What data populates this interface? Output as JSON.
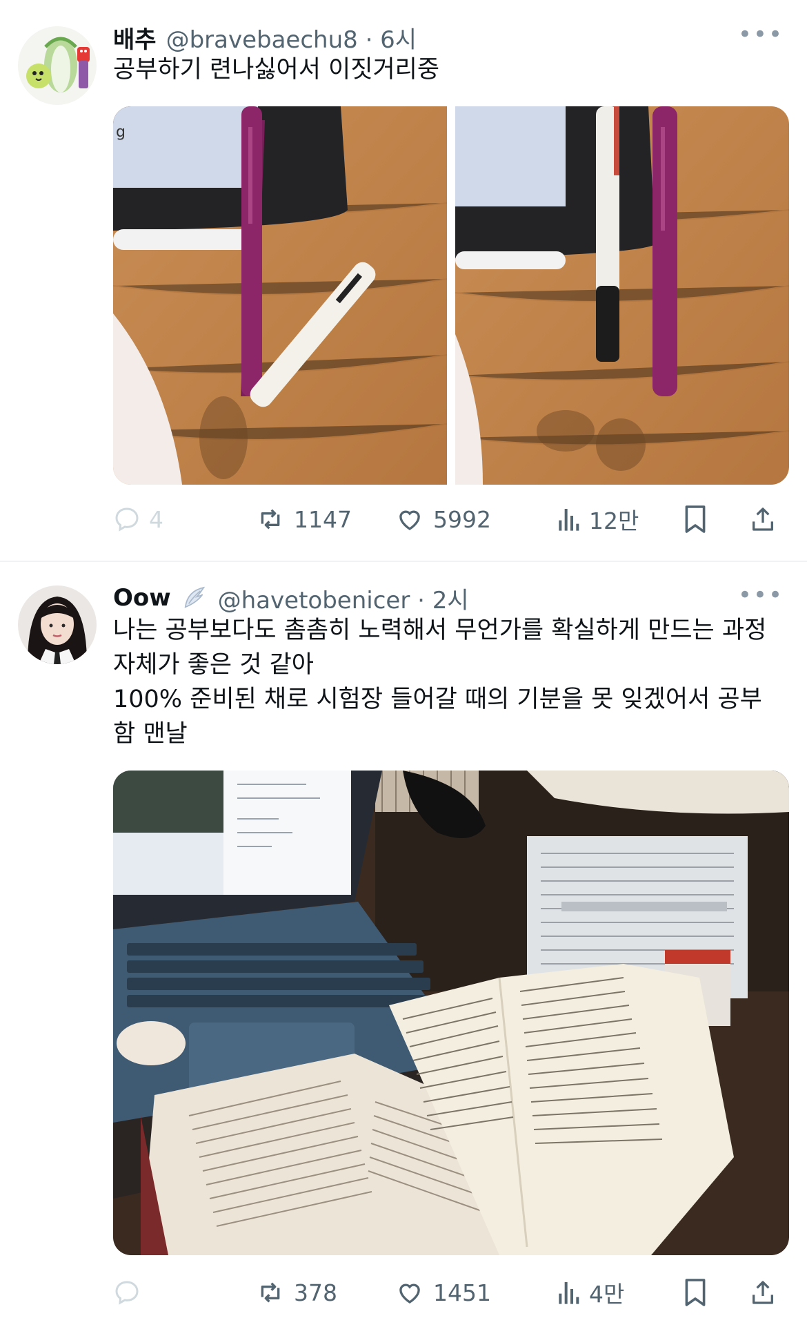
{
  "tweets": [
    {
      "name": "배추",
      "handle": "@bravebaechu8 · 6시",
      "more": "•••",
      "lines": [
        "공부하기 련나싫어서 이짓거리중"
      ],
      "media": [
        {
          "description": "Pink pen standing upright on a wooden desk beside a tablet and a white stylus"
        },
        {
          "description": "Pink pen and white multi-pen both standing upright on a wooden desk"
        }
      ],
      "stats": {
        "replies": "4",
        "retweets": "1147",
        "likes": "5992",
        "views": "12만"
      }
    },
    {
      "name": "Oow",
      "handle": "@havetobenicer · 2시",
      "more": "•••",
      "lines": [
        "나는 공부보다도 촘촘히 노력해서 무언가를 확실하게 만드는 과정",
        "자체가 좋은 것 같아",
        "100% 준비된 채로 시험장 들어갈 때의 기분을 못 잊겠어서 공부",
        "함 맨날"
      ],
      "media": [
        {
          "description": "Desk with laptop, open textbook, printed notes and exam papers"
        }
      ],
      "stats": {
        "replies": "",
        "retweets": "378",
        "likes": "1451",
        "views": "4만"
      }
    }
  ],
  "icons": {
    "reply": "reply-icon",
    "retweet": "retweet-icon",
    "like": "heart-icon",
    "views": "views-icon",
    "bookmark": "bookmark-icon",
    "share": "share-icon"
  },
  "colors": {
    "text": "#0f1419",
    "secondary": "#536471",
    "faded_reply": "#cfd9de",
    "divider": "#eff3f4"
  }
}
